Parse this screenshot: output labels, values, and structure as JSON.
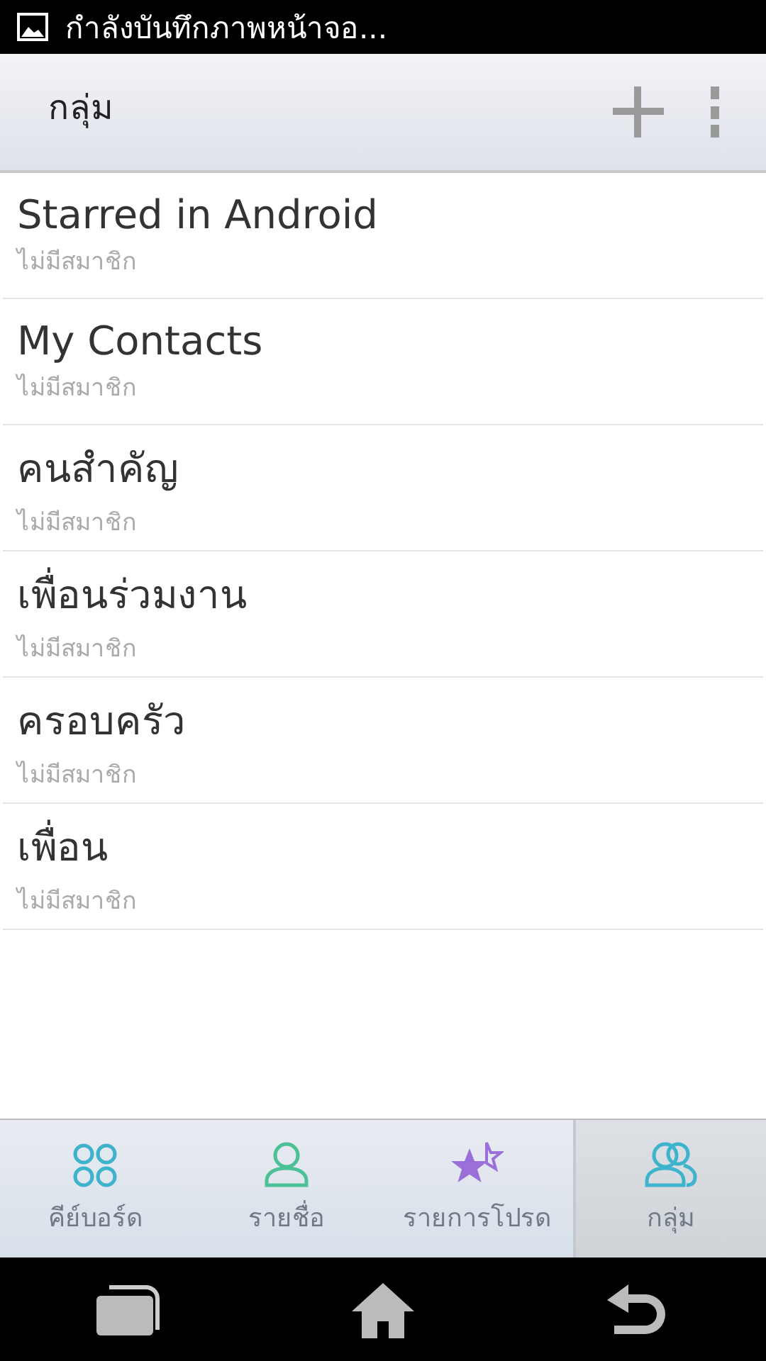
{
  "status_bar": {
    "notification": "กำลังบันทึกภาพหน้าจอ..."
  },
  "action_bar": {
    "title": "กลุ่ม"
  },
  "groups": [
    {
      "name": "Starred in Android",
      "members": "ไม่มีสมาชิก"
    },
    {
      "name": "My Contacts",
      "members": "ไม่มีสมาชิก"
    },
    {
      "name": "คนสำคัญ",
      "members": "ไม่มีสมาชิก"
    },
    {
      "name": "เพื่อนร่วมงาน",
      "members": "ไม่มีสมาชิก"
    },
    {
      "name": "ครอบครัว",
      "members": "ไม่มีสมาชิก"
    },
    {
      "name": "เพื่อน",
      "members": "ไม่มีสมาชิก"
    }
  ],
  "tabs": [
    {
      "label": "คีย์บอร์ด",
      "kind": "dialpad",
      "selected": false
    },
    {
      "label": "รายชื่อ",
      "kind": "person",
      "selected": false
    },
    {
      "label": "รายการโปรด",
      "kind": "stars",
      "selected": false
    },
    {
      "label": "กลุ่ม",
      "kind": "people",
      "selected": true
    }
  ]
}
